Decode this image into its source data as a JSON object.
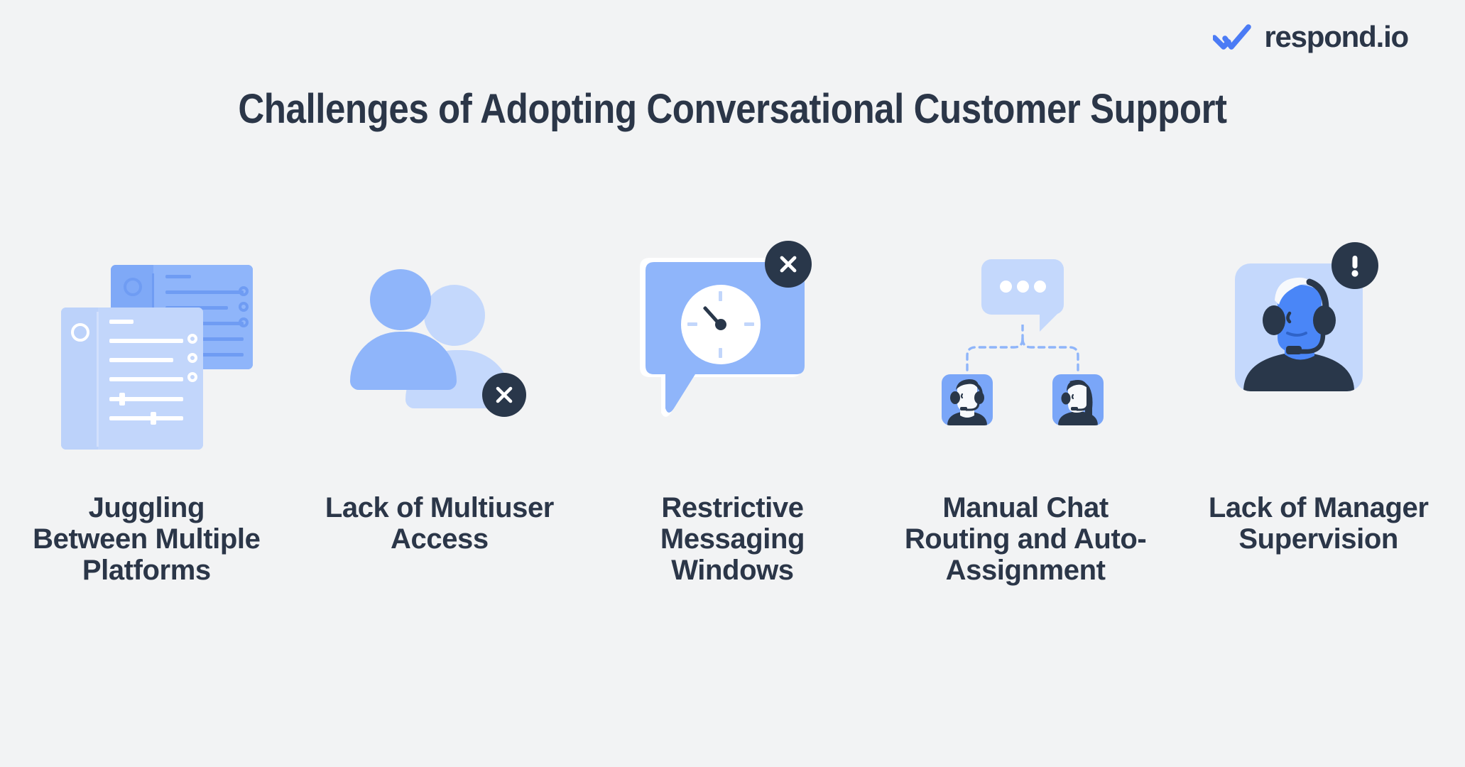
{
  "brand": {
    "name": "respond.io",
    "mark_icon": "double-check-icon",
    "mark_color": "#4b7bf5",
    "text_color": "#2b3648"
  },
  "headline": "Challenges of Adopting Conversational Customer Support",
  "background_color": "#f2f3f4",
  "palette": {
    "ink": "#2b3648",
    "badge": "#29374a",
    "blue_mid": "#7aa6f8",
    "blue_light": "#c4d8fc",
    "blue_pale": "#dbe6fd",
    "white": "#ffffff"
  },
  "cards": [
    {
      "id": "juggling-multiple-platforms",
      "label": "Juggling Between Multiple Platforms",
      "art": "two-app-windows",
      "badge": null
    },
    {
      "id": "lack-of-multiuser-access",
      "label": "Lack of Multiuser Access",
      "art": "two-users",
      "badge": "close-x"
    },
    {
      "id": "restrictive-messaging-windows",
      "label": "Restrictive Messaging Windows",
      "art": "chat-bubble-clock",
      "badge": "close-x"
    },
    {
      "id": "manual-chat-routing",
      "label": "Manual Chat Routing and Auto-Assignment",
      "art": "routing-agents",
      "badge": null
    },
    {
      "id": "lack-of-manager-supervision",
      "label": "Lack of Manager Supervision",
      "art": "supervisor-headset",
      "badge": "alert-exclamation"
    }
  ]
}
